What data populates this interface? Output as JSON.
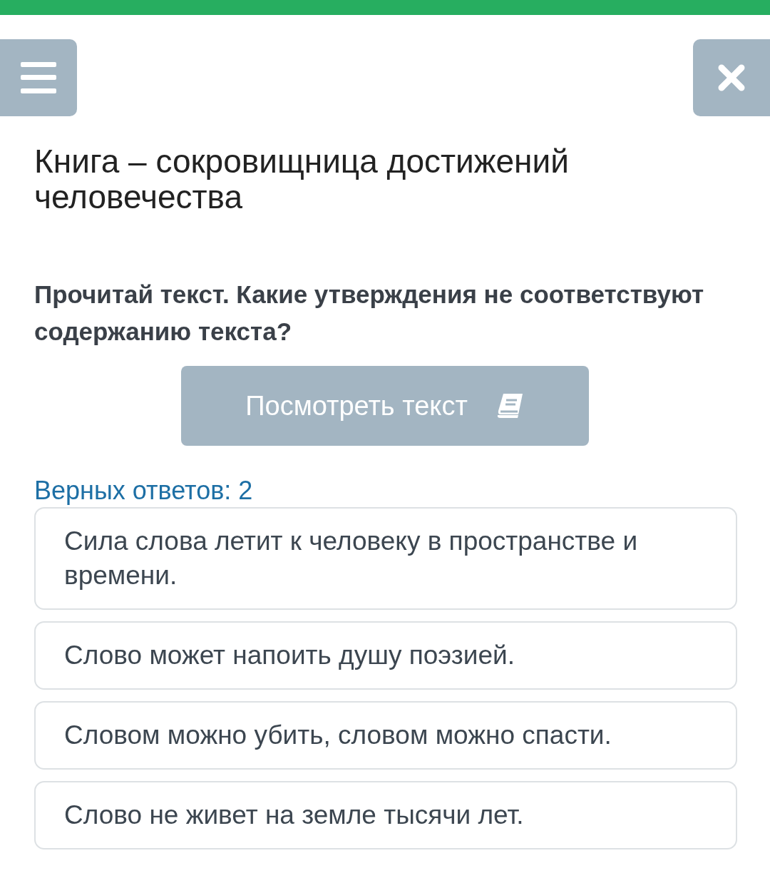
{
  "progress": {
    "level": 1
  },
  "title": "Книга – сокровищница достижений человечества",
  "question": "Прочитай текст. Какие утверждения не соответствуют содержанию текста?",
  "view_text_button": {
    "label": "Посмотреть текст"
  },
  "answer_count": "Верных ответов: 2",
  "options": [
    {
      "text": "Сила слова летит к человеку в пространстве и времени.",
      "selected": false
    },
    {
      "text": "Слово может напоить душу поэзией.",
      "selected": false
    },
    {
      "text": "Словом можно убить, словом можно спасти.",
      "selected": false
    },
    {
      "text": "Слово не живет на земле тысячи лет.",
      "selected": false
    }
  ]
}
